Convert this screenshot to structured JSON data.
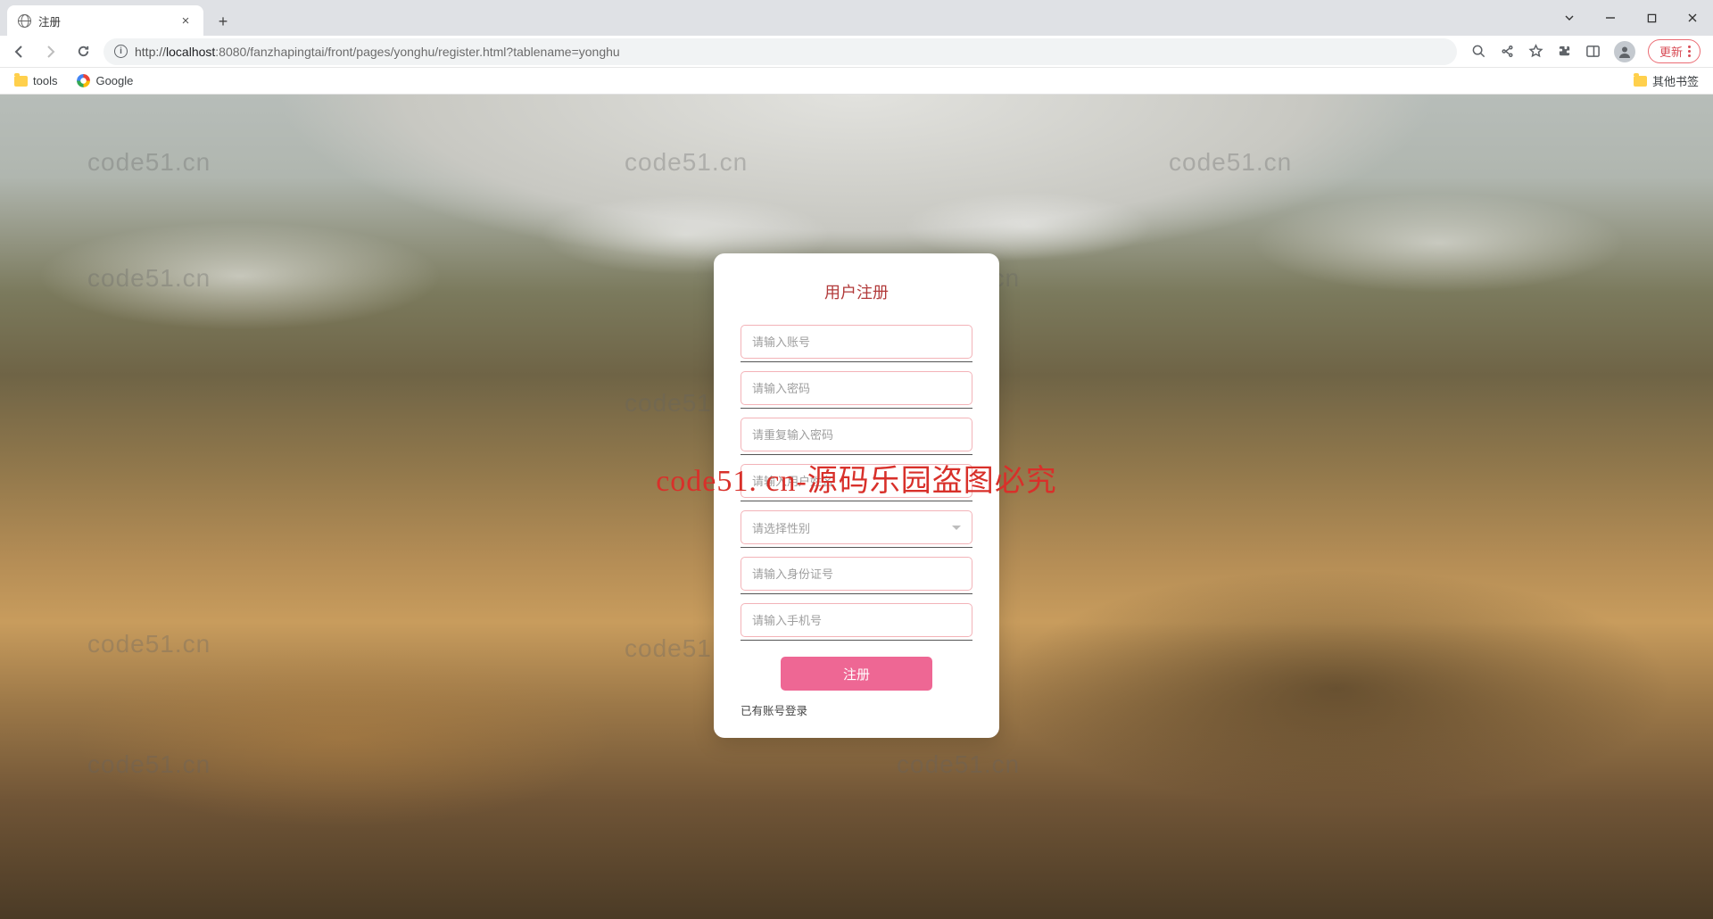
{
  "browser": {
    "tab_title": "注册",
    "url_prefix": "http://",
    "url_host": "localhost",
    "url_rest": ":8080/fanzhapingtai/front/pages/yonghu/register.html?tablename=yonghu",
    "update_label": "更新",
    "bookmarks": {
      "tools": "tools",
      "google": "Google",
      "other": "其他书签"
    }
  },
  "page": {
    "title": "用户注册",
    "fields": {
      "account_ph": "请输入账号",
      "password_ph": "请输入密码",
      "password2_ph": "请重复输入密码",
      "name_ph": "请输入用户姓名",
      "gender_ph": "请选择性别",
      "idcard_ph": "请输入身份证号",
      "phone_ph": "请输入手机号"
    },
    "submit_label": "注册",
    "login_link": "已有账号登录"
  },
  "watermark": {
    "text": "code51.cn",
    "banner": "code51. cn-源码乐园盗图必究"
  }
}
